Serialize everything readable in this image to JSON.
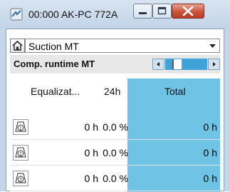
{
  "window": {
    "title": "00:000 AK-PC 772A"
  },
  "selector": {
    "value": "Suction MT"
  },
  "section": {
    "title": "Comp. runtime MT"
  },
  "columns": {
    "equalization": "Equalizat...",
    "period": "24h",
    "total": "Total"
  },
  "rows": [
    {
      "icon": "compressor-1-icon",
      "equalization": "0 h",
      "percent": "0.0 %",
      "total": "0 h"
    },
    {
      "icon": "compressor-2-icon",
      "equalization": "0 h",
      "percent": "0.0 %",
      "total": "0 h"
    },
    {
      "icon": "compressor-3-icon",
      "equalization": "0 h",
      "percent": "0.0 %",
      "total": "0 h"
    }
  ],
  "colors": {
    "accent": "#3fa3d9",
    "total_column": "#6fc3e5",
    "titlebar": "#c4d6ea"
  }
}
